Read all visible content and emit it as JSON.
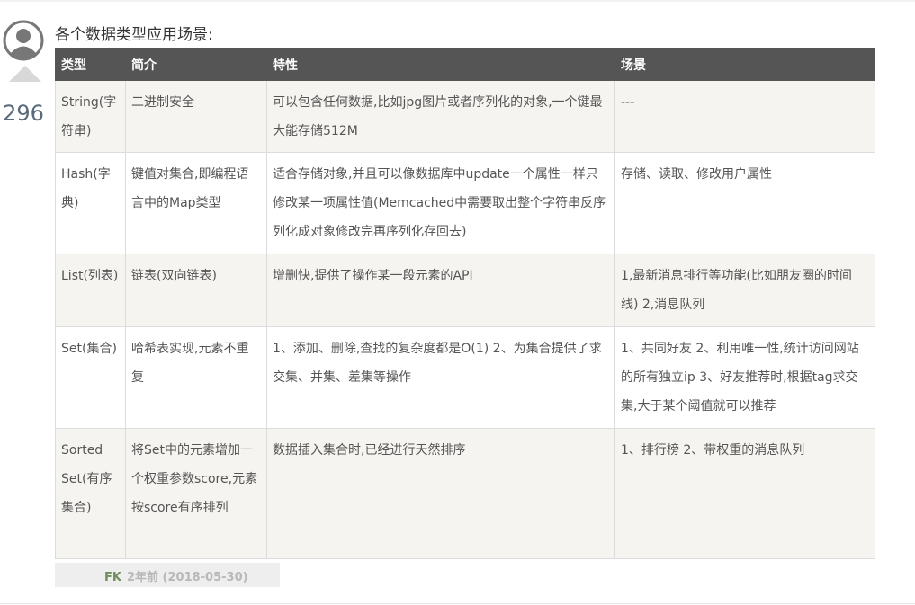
{
  "vote": {
    "count": "296"
  },
  "intro": "各个数据类型应用场景:",
  "table": {
    "headers": [
      "类型",
      "简介",
      "特性",
      "场景"
    ],
    "rows": [
      [
        "String(字符串)",
        "二进制安全",
        "可以包含任何数据,比如jpg图片或者序列化的对象,一个键最大能存储512M",
        "---"
      ],
      [
        "Hash(字典)",
        "键值对集合,即编程语言中的Map类型",
        "适合存储对象,并且可以像数据库中update一个属性一样只修改某一项属性值(Memcached中需要取出整个字符串反序列化成对象修改完再序列化存回去)",
        "存储、读取、修改用户属性"
      ],
      [
        "List(列表)",
        "链表(双向链表)",
        "增删快,提供了操作某一段元素的API",
        "1,最新消息排行等功能(比如朋友圈的时间线) 2,消息队列"
      ],
      [
        "Set(集合)",
        "哈希表实现,元素不重复",
        "1、添加、删除,查找的复杂度都是O(1) 2、为集合提供了求交集、并集、差集等操作",
        "1、共同好友 2、利用唯一性,统计访问网站的所有独立ip 3、好友推荐时,根据tag求交集,大于某个阈值就可以推荐"
      ],
      [
        "Sorted Set(有序集合)",
        "将Set中的元素增加一个权重参数score,元素按score有序排列",
        "数据插入集合时,已经进行天然排序",
        "1、排行榜 2、带权重的消息队列"
      ]
    ]
  },
  "footer": {
    "user": "FK",
    "time": "2年前 (2018-05-30)"
  },
  "icons": {
    "avatar": "user-avatar-icon",
    "vote": "vote-up-icon"
  },
  "colors": {
    "header_bg": "#555555",
    "odd_row_bg": "#f5f4f0"
  }
}
